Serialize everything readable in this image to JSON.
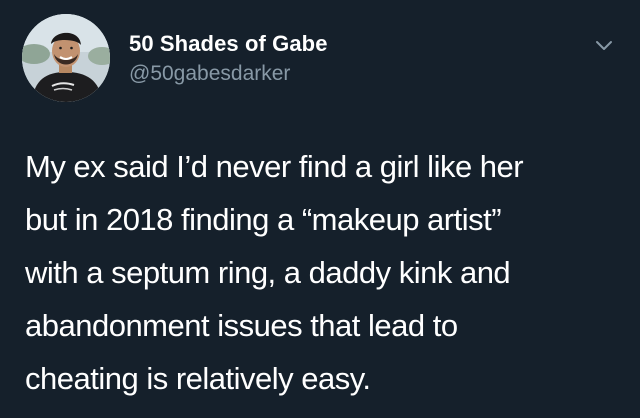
{
  "user": {
    "display_name": "50 Shades of Gabe",
    "handle": "@50gabesdarker",
    "avatar": "profile-photo"
  },
  "menu": {
    "icon": "chevron-down-icon"
  },
  "tweet": {
    "lines": [
      "My ex said I’d never find a girl like her",
      "but in 2018 finding a “makeup artist”",
      "with a septum ring, a daddy kink and",
      "abandonment issues that lead to",
      "cheating is relatively easy."
    ]
  },
  "colors": {
    "background": "#15202b",
    "text": "#ffffff",
    "handle": "#8899a6"
  }
}
